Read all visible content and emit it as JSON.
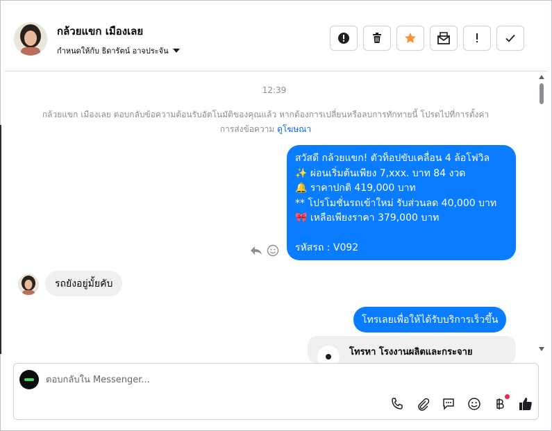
{
  "header": {
    "contact_name": "กล้วยแขก เมืองเลย",
    "assigned_to": "กำหนดให้กับ ธิดารัตน์ อาจประจัน",
    "actions": [
      {
        "name": "report-button",
        "icon": "exclamation-circle-icon"
      },
      {
        "name": "delete-button",
        "icon": "trash-icon"
      },
      {
        "name": "star-button",
        "icon": "star-icon",
        "color": "#f7923b"
      },
      {
        "name": "mark-unread-button",
        "icon": "envelope-icon"
      },
      {
        "name": "priority-button",
        "icon": "exclamation-icon"
      },
      {
        "name": "done-button",
        "icon": "check-icon"
      }
    ]
  },
  "thread": {
    "timestamp": "12:39",
    "system_notice": "กล้วยแขก เมืองเลย ตอบกลับข้อความต้อนรับอัตโนมัติของคุณแล้ว หากต้องการเปลี่ยนหรือลบการทักทายนี้ โปรดไปที่การตั้งค่า",
    "system_notice_2": "การส่งข้อความ",
    "system_link": "ดูโฆษณา",
    "outgoing_1": {
      "line1": "สวัสดี กล้วยแขก!  ตัวท็อปขับเคลื่อน 4 ล้อโฟวิล",
      "line2": "✨  ผ่อนเริ่มต้นเพียง 7,xxx. บาท 84 งวด",
      "line3": "🔔 ราคาปกติ 419,000 บาท",
      "line4": "** โปรโมชั่นรถเข้าใหม่ รับส่วนลด 40,000 บาท",
      "line5": "🎀  เหลือเพียงราคา 379,000 บาท",
      "line6": "",
      "line7": " รหัสรถ : V092"
    },
    "incoming_1": "รถยังอยู่มั้ยคับ",
    "outgoing_2": "โทรเลยเพื่อให้ได้รับบริการเร็วขึ้น",
    "card_title": "โทรหา โรงงานผลิตและกระจาย"
  },
  "composer": {
    "placeholder": "ตอบกลับใน Messenger...",
    "tools": [
      "phone-icon",
      "paperclip-icon",
      "saved-reply-icon",
      "emoji-icon",
      "baht-icon",
      "thumbs-up-icon"
    ]
  },
  "colors": {
    "accent": "#0a7cff",
    "link": "#0866ff",
    "star": "#f7923b",
    "notification_dot": "#f02849"
  }
}
